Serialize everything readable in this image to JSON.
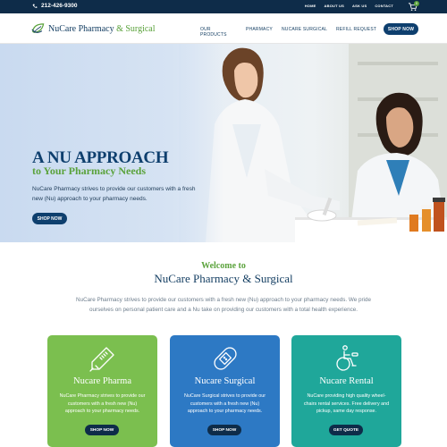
{
  "topbar": {
    "phone": "212-426-9300",
    "links": [
      "HOME",
      "ABOUT US",
      "ASK US",
      "CONTACT"
    ],
    "cart_count": "0"
  },
  "header": {
    "logo_main": "NuCare Pharmacy",
    "logo_amp": "&",
    "logo_surgical": "Surgical",
    "nav": [
      "OUR PRODUCTS",
      "PHARMACY",
      "NUCARE SURGICAL",
      "REFILL REQUEST"
    ],
    "shop_now": "SHOP NOW"
  },
  "hero": {
    "headline": "A NU APPROACH",
    "subheadline": "to Your Pharmacy Needs",
    "text": "NuCare Pharmacy strives to provide our customers with a fresh new (Nu) approach to your pharmacy needs.",
    "button": "SHOP NOW"
  },
  "welcome": {
    "kicker": "Welcome to",
    "title": "NuCare Pharmacy & Surgical",
    "text": "NuCare Pharmacy strives to provide our customers with a fresh new (Nu) approach to your pharmacy needs. We pride ourselves on personal patient care and a Nu take on providing our customers with a total health experience."
  },
  "cards": [
    {
      "title": "Nucare Pharma",
      "text": "NuCare Pharmacy strives to provide our customers with a fresh new (Nu) approach to your pharmacy needs.",
      "button": "SHOP NOW",
      "icon": "thermometer-icon",
      "color": "#7bbf4f"
    },
    {
      "title": "Nucare Surgical",
      "text": "NuCare Surgical strives to provide our customers with a fresh new (Nu) approach to your pharmacy needs.",
      "button": "SHOP NOW",
      "icon": "bandage-icon",
      "color": "#2d79c4"
    },
    {
      "title": "Nucare Rental",
      "text": "NuCare providing high quality wheel-chairs rental services. Free delivery and pickup, same day response.",
      "button": "GET QUOTE",
      "icon": "wheelchair-icon",
      "color": "#1fa79a"
    }
  ],
  "colors": {
    "navy": "#0e2c49",
    "brand_blue": "#0e3f6e",
    "brand_green": "#5aa23b"
  }
}
